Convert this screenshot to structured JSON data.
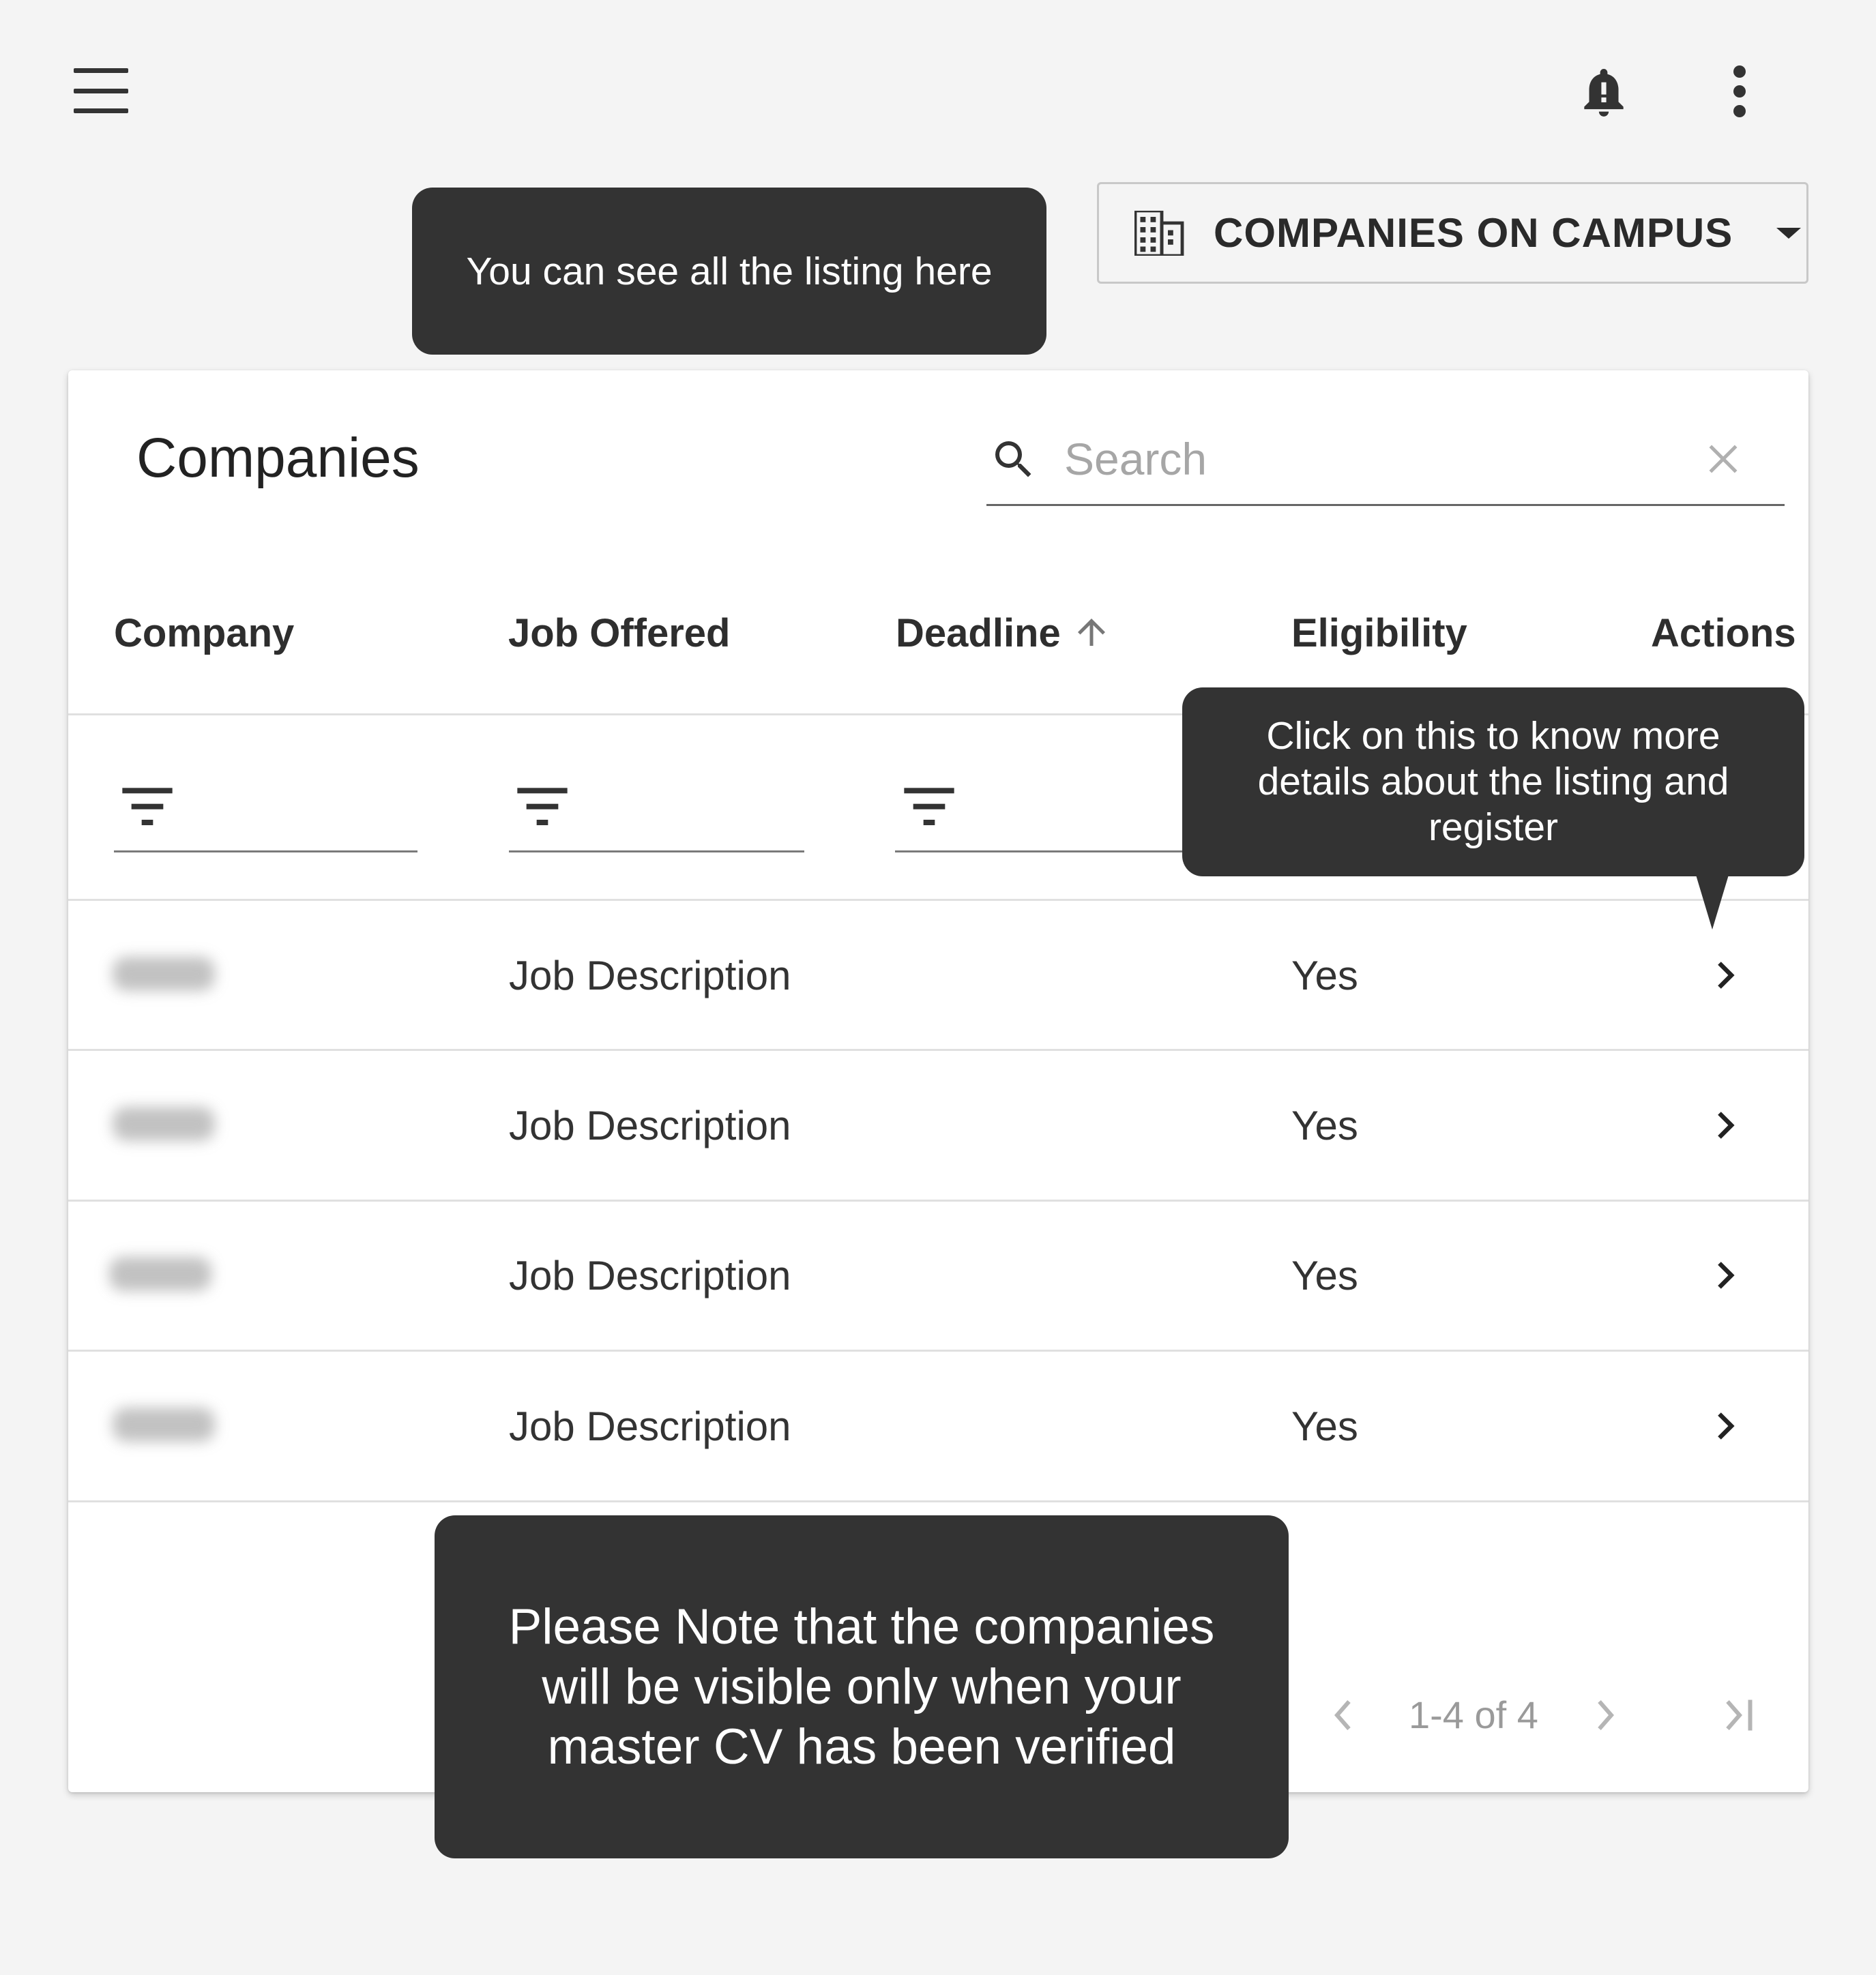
{
  "header": {
    "menu_icon": "menu-icon",
    "notification_icon": "bell-alert-icon",
    "more_icon": "more-vert-icon"
  },
  "dropdown": {
    "icon": "building-icon",
    "label": "COMPANIES ON CAMPUS"
  },
  "tooltips": {
    "listing": "You can see all the listing here",
    "details": "Click on this to know more details about the listing and register",
    "note": "Please Note that the companies will be visible only when your master CV has been verified"
  },
  "card": {
    "title": "Companies",
    "search_placeholder": "Search"
  },
  "table": {
    "columns": [
      "Company",
      "Job Offered",
      "Deadline",
      "Eligibility",
      "Actions"
    ],
    "sort": {
      "column": "Deadline",
      "direction": "ascending"
    },
    "rows": [
      {
        "company": "",
        "job_offered": "Job Description",
        "deadline": "",
        "eligibility": "Yes"
      },
      {
        "company": "",
        "job_offered": "Job Description",
        "deadline": "",
        "eligibility": "Yes"
      },
      {
        "company": "",
        "job_offered": "Job Description",
        "deadline": "",
        "eligibility": "Yes"
      },
      {
        "company": "",
        "job_offered": "Job Description",
        "deadline": "",
        "eligibility": "Yes"
      }
    ]
  },
  "pagination": {
    "range": "1-4 of 4"
  },
  "colors": {
    "tooltip_bg": "#333333",
    "page_bg": "#f4f4f4"
  }
}
